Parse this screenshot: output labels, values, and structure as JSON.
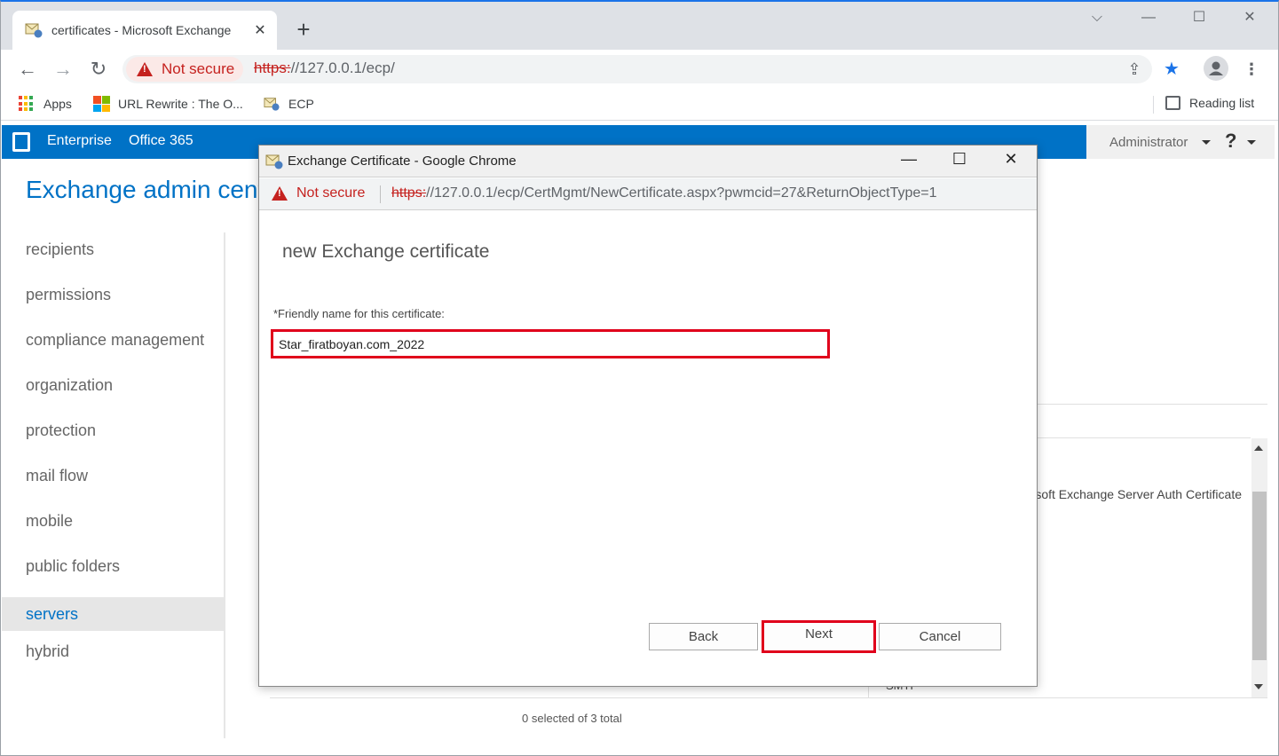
{
  "browser": {
    "tab_title": "certificates - Microsoft Exchange",
    "tab_close": "✕",
    "new_tab": "+",
    "not_secure": "Not secure",
    "url_scheme": "https:",
    "url_rest": "//127.0.0.1/ecp/",
    "bookmarks": {
      "apps": "Apps",
      "url_rewrite": "URL Rewrite : The O...",
      "ecp": "ECP",
      "reading_list": "Reading list"
    }
  },
  "o365": {
    "enterprise": "Enterprise",
    "office365": "Office 365",
    "admin": "Administrator",
    "help": "?"
  },
  "eac": {
    "title": "Exchange admin center",
    "nav": [
      "recipients",
      "permissions",
      "compliance management",
      "organization",
      "protection",
      "mail flow",
      "mobile",
      "public folders",
      "servers",
      "hybrid"
    ],
    "active_nav": "servers",
    "bg_cert_text": "Microsoft Exchange Server Auth Certificate",
    "bg_smtp": "SMTP",
    "selection_status": "0 selected of 3 total"
  },
  "popup": {
    "title": "Exchange Certificate - Google Chrome",
    "not_secure": "Not secure",
    "url_scheme": "https:",
    "url_rest": "//127.0.0.1/ecp/CertMgmt/NewCertificate.aspx?pwmcid=27&ReturnObjectType=1",
    "heading": "new Exchange certificate",
    "field_label": "*Friendly name for this certificate:",
    "field_value": "Star_firatboyan.com_2022",
    "buttons": {
      "back": "Back",
      "next": "Next",
      "cancel": "Cancel"
    }
  },
  "colors": {
    "accent": "#0072c6",
    "highlight": "#e0001b",
    "warning": "#c5221f"
  }
}
